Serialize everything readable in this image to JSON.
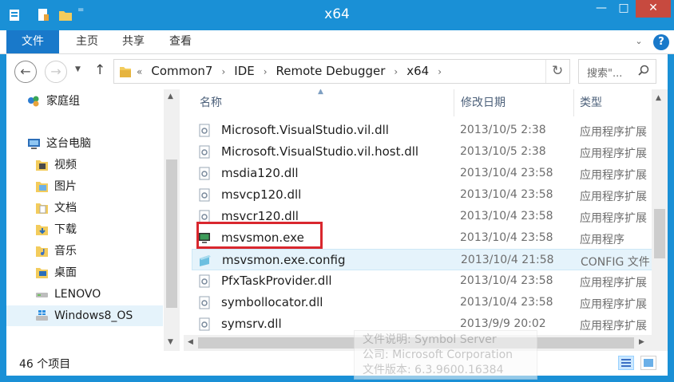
{
  "window": {
    "title": "x64"
  },
  "controls": {
    "minimize": "—",
    "maximize": "□",
    "close": "✕"
  },
  "ribbon": {
    "tabs": [
      "文件",
      "主页",
      "共享",
      "查看"
    ],
    "help": "?"
  },
  "address": {
    "prefix": "«",
    "segments": [
      "Common7",
      "IDE",
      "Remote Debugger",
      "x64"
    ],
    "search_placeholder": "搜索\"..."
  },
  "nav": {
    "items": [
      {
        "label": "家庭组",
        "icon": "homegroup-icon"
      },
      {
        "label": "这台电脑",
        "icon": "computer-icon"
      },
      {
        "label": "视频",
        "icon": "videos-folder-icon"
      },
      {
        "label": "图片",
        "icon": "pictures-folder-icon"
      },
      {
        "label": "文档",
        "icon": "documents-folder-icon"
      },
      {
        "label": "下载",
        "icon": "downloads-folder-icon"
      },
      {
        "label": "音乐",
        "icon": "music-folder-icon"
      },
      {
        "label": "桌面",
        "icon": "desktop-folder-icon"
      },
      {
        "label": "LENOVO",
        "icon": "drive-icon"
      },
      {
        "label": "Windows8_OS",
        "icon": "system-drive-icon"
      }
    ]
  },
  "columns": {
    "name": "名称",
    "date": "修改日期",
    "type": "类型"
  },
  "files": [
    {
      "name": "Microsoft.VisualStudio.vil.dll",
      "date": "2013/10/5 2:38",
      "type": "应用程序扩展"
    },
    {
      "name": "Microsoft.VisualStudio.vil.host.dll",
      "date": "2013/10/5 2:38",
      "type": "应用程序扩展"
    },
    {
      "name": "msdia120.dll",
      "date": "2013/10/4 23:58",
      "type": "应用程序扩展"
    },
    {
      "name": "msvcp120.dll",
      "date": "2013/10/4 23:58",
      "type": "应用程序扩展"
    },
    {
      "name": "msvcr120.dll",
      "date": "2013/10/4 23:58",
      "type": "应用程序扩展"
    },
    {
      "name": "msvsmon.exe",
      "date": "2013/10/4 23:58",
      "type": "应用程序"
    },
    {
      "name": "msvsmon.exe.config",
      "date": "2013/10/4 21:58",
      "type": "CONFIG 文件"
    },
    {
      "name": "PfxTaskProvider.dll",
      "date": "2013/10/4 23:58",
      "type": "应用程序扩展"
    },
    {
      "name": "symbollocator.dll",
      "date": "2013/10/4 23:58",
      "type": "应用程序扩展"
    },
    {
      "name": "symsrv.dll",
      "date": "2013/9/9 20:02",
      "type": "应用程序扩展"
    }
  ],
  "status": {
    "count": "46 个项目"
  },
  "tooltip": {
    "line1": "文件说明: Symbol Server",
    "line2": "公司: Microsoft Corporation",
    "line3": "文件版本: 6.3.9600.16384"
  },
  "colors": {
    "accent": "#1a90d6",
    "file_tab": "#1979ca",
    "close": "#c74a3f",
    "highlight": "#e5f3fb",
    "callout": "#d9272e"
  }
}
